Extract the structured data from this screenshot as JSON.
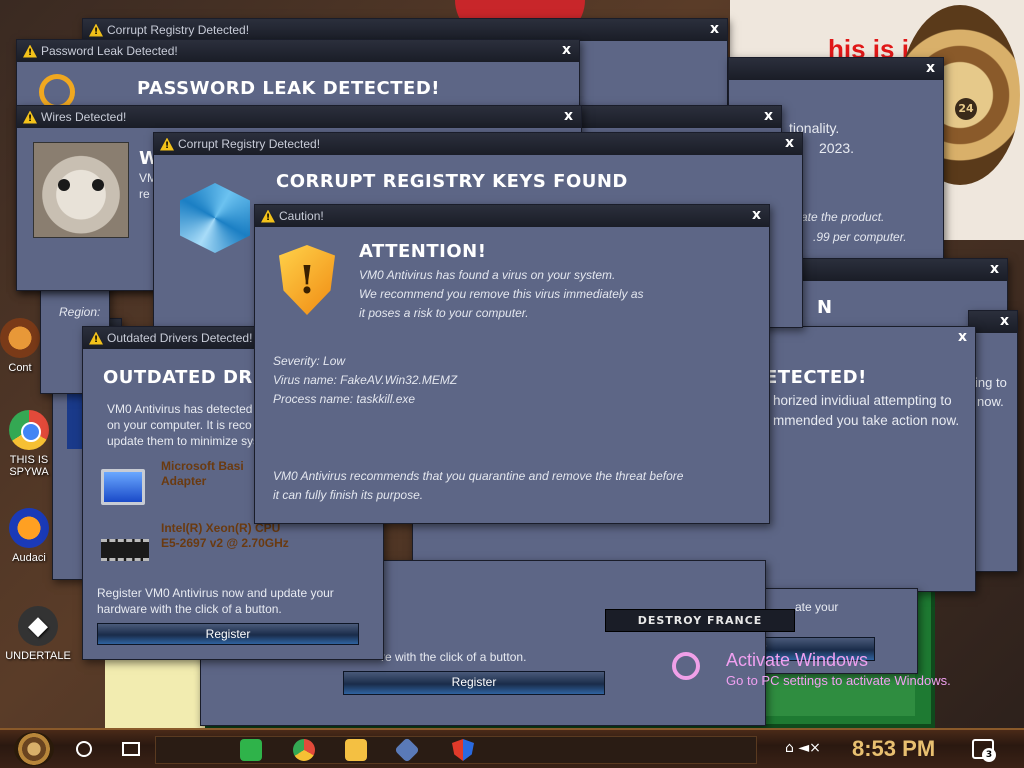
{
  "wallpaper": {
    "text": "his is jus",
    "clock_number": "24"
  },
  "desktop_icons": [
    {
      "label": "Cont"
    },
    {
      "label": "THIS IS SPYWA"
    },
    {
      "label": "Audaci"
    },
    {
      "label": "UNDERTALE"
    }
  ],
  "windows": {
    "corrupt_back": {
      "title": "Corrupt Registry Detected!",
      "close": "x"
    },
    "password": {
      "title": "Password Leak Detected!",
      "close": "x",
      "heading": "PASSWORD LEAK DETECTED!"
    },
    "wires": {
      "title": "Wires Detected!",
      "close": "x",
      "heading": "W",
      "text": "VM re"
    },
    "right_back": {
      "close": "x",
      "line1": "tionality.",
      "line2": "2023.",
      "line3": "ate the product.",
      "line4": ".99 per computer."
    },
    "right_mid": {
      "close": "x",
      "text": "N"
    },
    "hacker": {
      "close": "x",
      "heading": "ETECTED!",
      "line1": "horized invidiual attempting to",
      "line2": "mmended you take action now."
    },
    "far_right": {
      "close": "x",
      "line1": "ing to",
      "line2": "now."
    },
    "corrupt_front": {
      "title": "Corrupt Registry Detected!",
      "close": "x",
      "heading": "CORRUPT REGISTRY KEYS FOUND"
    },
    "region": {
      "label": "Region:"
    },
    "outdated": {
      "title": "Outdated Drivers Detected!",
      "heading": "OUTDATED DRIVE",
      "text_line1": "VM0 Antivirus has detected",
      "text_line2": "on your computer. It is reco",
      "text_line3": "update them to minimize sys",
      "device1_line1": "Microsoft Basi",
      "device1_line2": "Adapter",
      "device2_line1": "Intel(R) Xeon(R) CPU",
      "device2_line2": "E5-2697 v2 @ 2.70GHz",
      "footer_line1": "Register VM0 Antivirus now and update your",
      "footer_line2": "hardware with the click of a button.",
      "register": "Register"
    },
    "caution": {
      "title": "Caution!",
      "close": "x",
      "heading": "ATTENTION!",
      "intro_line1": "VM0 Antivirus has found a virus on your system.",
      "intro_line2": "We recommend you remove this virus immediately as",
      "intro_line3": "it poses a risk to your computer.",
      "severity": "Severity: Low",
      "virus_name": "Virus name: FakeAV.Win32.MEMZ",
      "process_name": "Process name: taskkill.exe",
      "footer_line1": "VM0 Antivirus recommends that you quarantine and remove the threat before",
      "footer_line2": "it can fully finish its purpose."
    },
    "bottom_register": {
      "text": "re with the click of a button.",
      "register": "Register"
    },
    "right_register": {
      "text": "ate your",
      "register": "Register"
    }
  },
  "destroy_button": "DESTROY FRANCE",
  "activate": {
    "heading": "Activate Windows",
    "subtext": "Go to PC settings to activate Windows."
  },
  "taskbar": {
    "time": "8:53 PM",
    "notification_count": "3"
  }
}
